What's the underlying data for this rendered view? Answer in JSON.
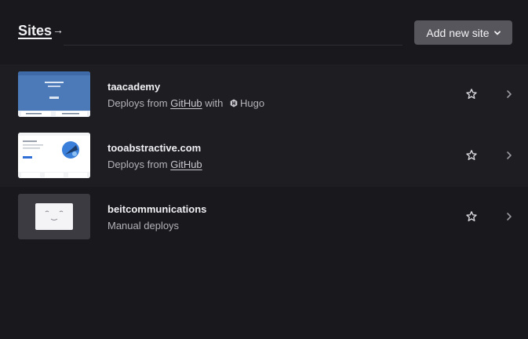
{
  "header": {
    "title": "Sites",
    "title_arrow": "→",
    "add_button_label": "Add new site"
  },
  "sites": [
    {
      "name": "taacademy",
      "deploy_prefix": "Deploys from ",
      "provider": "GitHub",
      "with_text": " with ",
      "framework": "Hugo",
      "thumbnail": "site-screenshot"
    },
    {
      "name": "tooabstractive.com",
      "deploy_prefix": "Deploys from ",
      "provider": "GitHub",
      "thumbnail": "site-screenshot"
    },
    {
      "name": "beitcommunications",
      "deploy_text": "Manual deploys",
      "thumbnail": "placeholder-face"
    }
  ],
  "icons": {
    "star": "star-outline-icon",
    "chevron_right": "chevron-right-icon",
    "chevron_down": "chevron-down-icon",
    "hugo": "hugo-logo-icon"
  },
  "colors": {
    "background": "#19181c",
    "row_alt": "#1e1d22",
    "button_bg": "#57565c",
    "text_primary": "#f1f1f4",
    "text_secondary": "#b3b2b8"
  }
}
